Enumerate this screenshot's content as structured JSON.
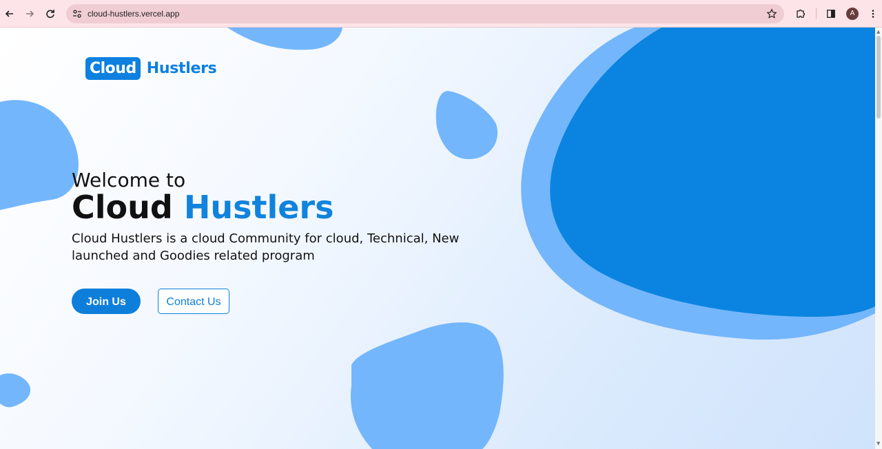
{
  "browser": {
    "url": "cloud-hustlers.vercel.app",
    "profile_initial": "A",
    "icons": {
      "back": "back-arrow-icon",
      "forward": "forward-arrow-icon",
      "reload": "reload-icon",
      "site_info": "site-settings-icon",
      "bookmark": "star-icon",
      "extensions": "puzzle-icon",
      "side_panel": "side-panel-icon",
      "menu": "kebab-menu-icon"
    }
  },
  "logo": {
    "boxed_text": "Cloud",
    "text": "Hustlers"
  },
  "hero": {
    "welcome": "Welcome to",
    "title_part1": "Cloud",
    "title_part2": "Hustlers",
    "description": "Cloud Hustlers is a cloud Community for cloud, Technical, New launched and Goodies related program"
  },
  "buttons": {
    "join": "Join Us",
    "contact": "Contact Us"
  },
  "colors": {
    "primary": "#0d7fdb",
    "blob_light": "#74b6fb",
    "blob_dark": "#0a84e0",
    "chrome_bg": "#fde4e8"
  }
}
